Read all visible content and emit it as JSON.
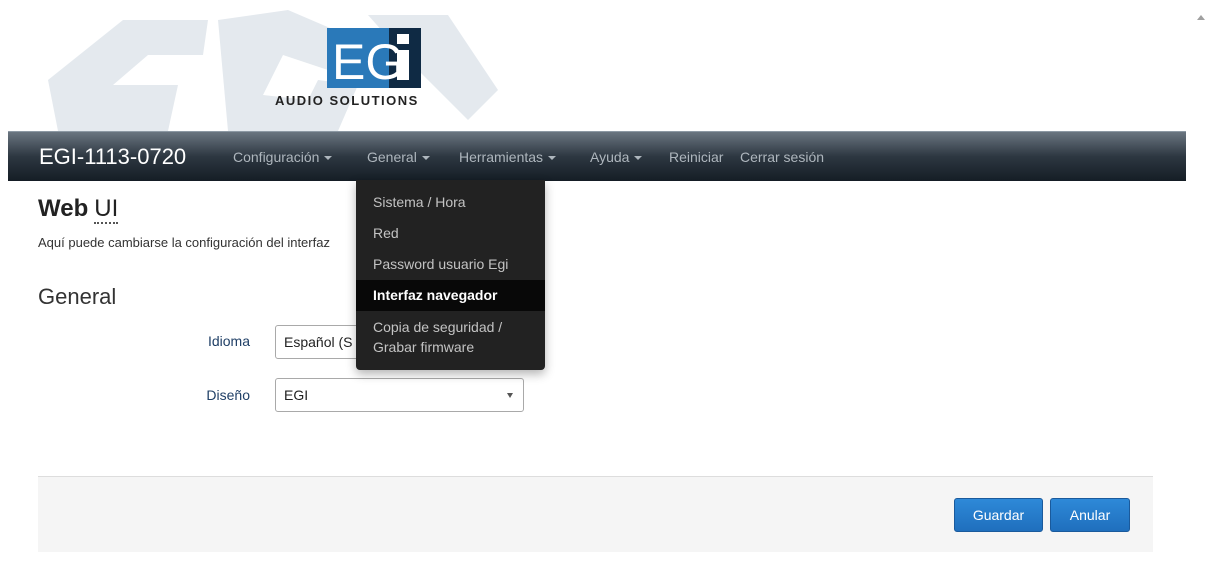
{
  "logo": {
    "main_text": "EGi",
    "sub_text": "AUDIO SOLUTIONS"
  },
  "navbar": {
    "brand": "EGI-1113-0720",
    "items": [
      {
        "label": "Configuración"
      },
      {
        "label": "General"
      },
      {
        "label": "Herramientas"
      },
      {
        "label": "Ayuda"
      },
      {
        "label": "Reiniciar"
      },
      {
        "label": "Cerrar sesión"
      }
    ]
  },
  "dropdown": {
    "items": [
      {
        "label": "Sistema / Hora"
      },
      {
        "label": "Red"
      },
      {
        "label": "Password usuario Egi"
      },
      {
        "label": "Interfaz navegador",
        "active": true
      },
      {
        "label_line1": "Copia de seguridad /",
        "label_line2": "Grabar firmware"
      }
    ]
  },
  "page": {
    "title_bold": "Web",
    "title_ui": "UI",
    "description": "Aquí puede cambiarse la configuración del interfaz"
  },
  "section": {
    "title": "General",
    "fields": [
      {
        "label": "Idioma",
        "value": "Español (S"
      },
      {
        "label": "Diseño",
        "value": "EGI"
      }
    ]
  },
  "footer": {
    "save_label": "Guardar",
    "cancel_label": "Anular"
  },
  "colors": {
    "navbar_dark": "#151d25",
    "dropdown_bg": "#222222",
    "button_blue": "#1f6fbd",
    "label_blue": "#1f3f66"
  }
}
